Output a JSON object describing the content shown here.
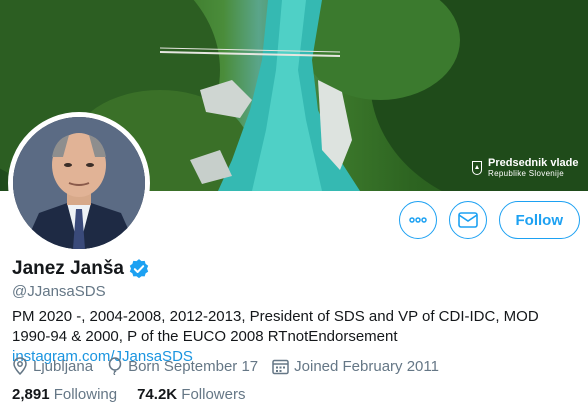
{
  "banner": {
    "logo_title": "Predsednik vlade",
    "logo_subtitle": "Republike Slovenije"
  },
  "profile": {
    "name": "Janez Janša",
    "handle": "@JJansaSDS",
    "bio": "PM 2020 -, 2004-2008, 2012-2013, President of SDS and VP of CDI-IDC, MOD 1990-94 & 2000, P of the EUCO 2008 RTnotEndorsement",
    "bio_link": "instagram.com/JJansaSDS",
    "location": "Ljubljana",
    "birthday": "Born September 17",
    "joined": "Joined February 2011",
    "verified": true
  },
  "actions": {
    "more_icon": "more-icon",
    "message_icon": "envelope-icon",
    "follow_label": "Follow"
  },
  "stats": {
    "following_count": "2,891",
    "following_label": "Following",
    "followers_count": "74.2K",
    "followers_label": "Followers"
  },
  "colors": {
    "accent": "#1da1f2",
    "link": "#1b95e0",
    "muted": "#657786",
    "text": "#14171a"
  }
}
